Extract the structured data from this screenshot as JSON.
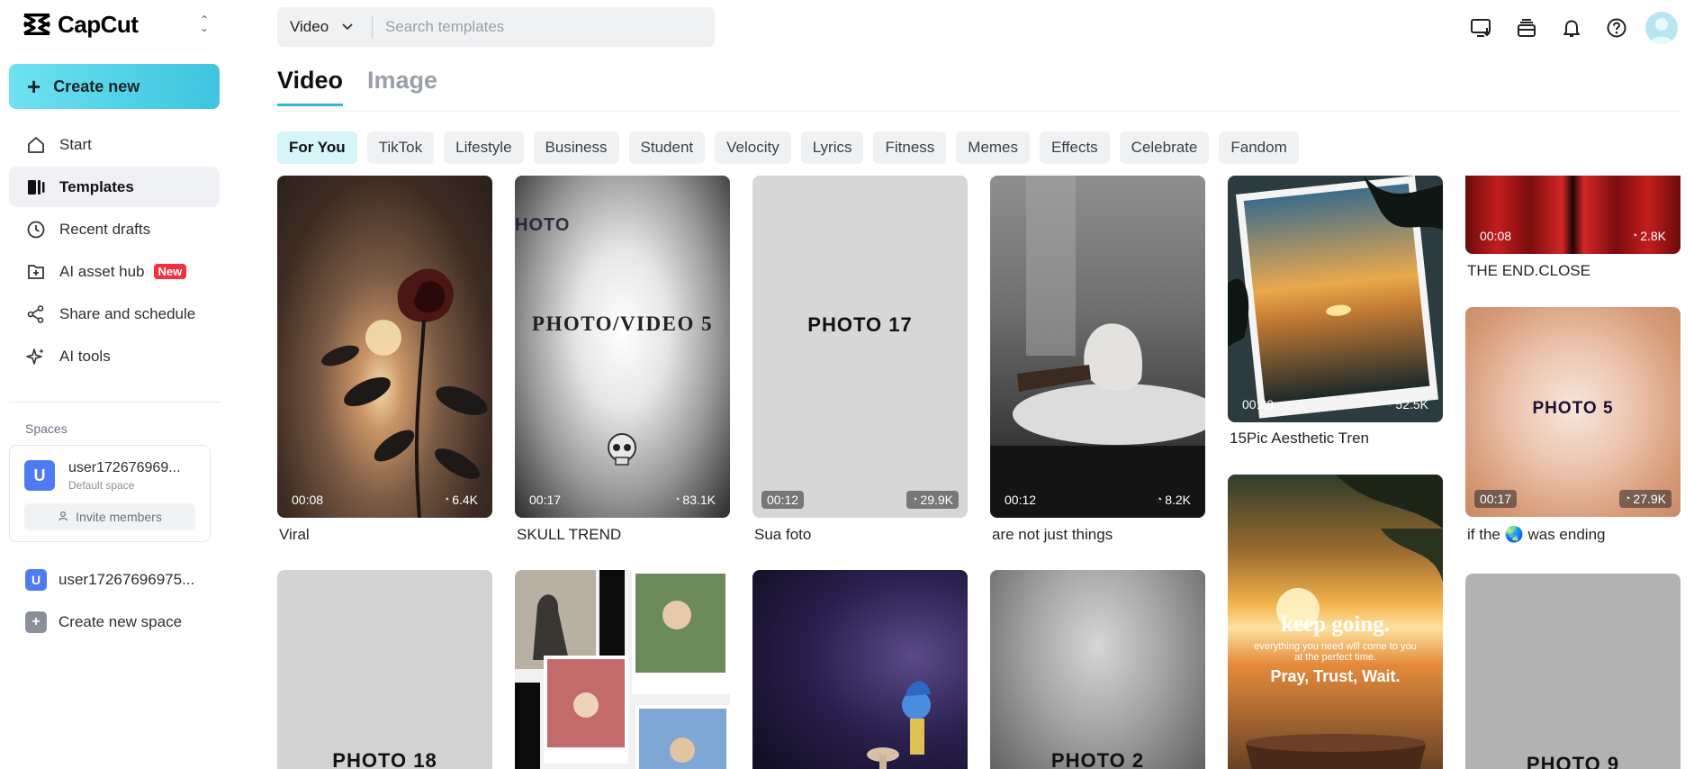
{
  "app": {
    "name": "CapCut"
  },
  "sidebar": {
    "create_label": "Create new",
    "items": [
      {
        "label": "Start",
        "icon": "home-icon"
      },
      {
        "label": "Templates",
        "icon": "templates-icon"
      },
      {
        "label": "Recent drafts",
        "icon": "clock-icon"
      },
      {
        "label": "AI asset hub",
        "icon": "asset-hub-icon",
        "badge": "New"
      },
      {
        "label": "Share and schedule",
        "icon": "share-icon"
      },
      {
        "label": "AI tools",
        "icon": "sparkle-icon"
      }
    ],
    "spaces_label": "Spaces",
    "space_card": {
      "avatar_letter": "U",
      "name": "user172676969...",
      "sub": "Default space",
      "invite_label": "Invite members"
    },
    "workspace": {
      "avatar_letter": "U",
      "name": "user17267696975..."
    },
    "create_space_label": "Create new space"
  },
  "search": {
    "type": "Video",
    "placeholder": "Search templates"
  },
  "tabs": [
    "Video",
    "Image"
  ],
  "chips": [
    "For You",
    "TikTok",
    "Lifestyle",
    "Business",
    "Student",
    "Velocity",
    "Lyrics",
    "Fitness",
    "Memes",
    "Effects",
    "Celebrate",
    "Fandom"
  ],
  "cards": [
    {
      "title": "Viral",
      "duration": "00:08",
      "uses": "6.4K",
      "thumb": "rose"
    },
    {
      "title": "SKULL TREND",
      "duration": "00:17",
      "uses": "83.1K",
      "thumb_text": "PHOTO/VIDEO 5",
      "thumb": "skull"
    },
    {
      "title": "Sua foto",
      "duration": "00:12",
      "uses": "29.9K",
      "thumb_text": "PHOTO 17",
      "thumb": "gray"
    },
    {
      "title": "are not just things",
      "duration": "00:12",
      "uses": "8.2K",
      "thumb": "statue"
    },
    {
      "title": "15Pic Aesthetic Tren",
      "duration": "00:20",
      "uses": "52.5K",
      "thumb": "sunset-frames"
    },
    {
      "title": "THE END.CLOSE",
      "duration": "00:08",
      "uses": "2.8K",
      "thumb": "curtain"
    },
    {
      "title": "if the 🌏 was ending",
      "duration": "00:17",
      "uses": "27.9K",
      "thumb_text": "PHOTO 5",
      "thumb": "peach"
    },
    {
      "thumb_text": "PHOTO 18",
      "thumb": "gray"
    },
    {
      "thumb": "collage"
    },
    {
      "thumb": "character"
    },
    {
      "thumb_text": "PHOTO 2",
      "thumb": "vignette"
    },
    {
      "thumb": "keep-going",
      "overlay": {
        "headline": "keep going.",
        "sub": "everything you need will come to you at the perfect time.",
        "tag": "Pray, Trust, Wait."
      }
    },
    {
      "thumb_text": "PHOTO 9",
      "thumb": "gray"
    }
  ],
  "colors": {
    "accent": "#2fb7d7",
    "create_gradient_start": "#6fe2f0",
    "badge_red": "#f2303f",
    "chip_active": "#d6f5fb"
  }
}
